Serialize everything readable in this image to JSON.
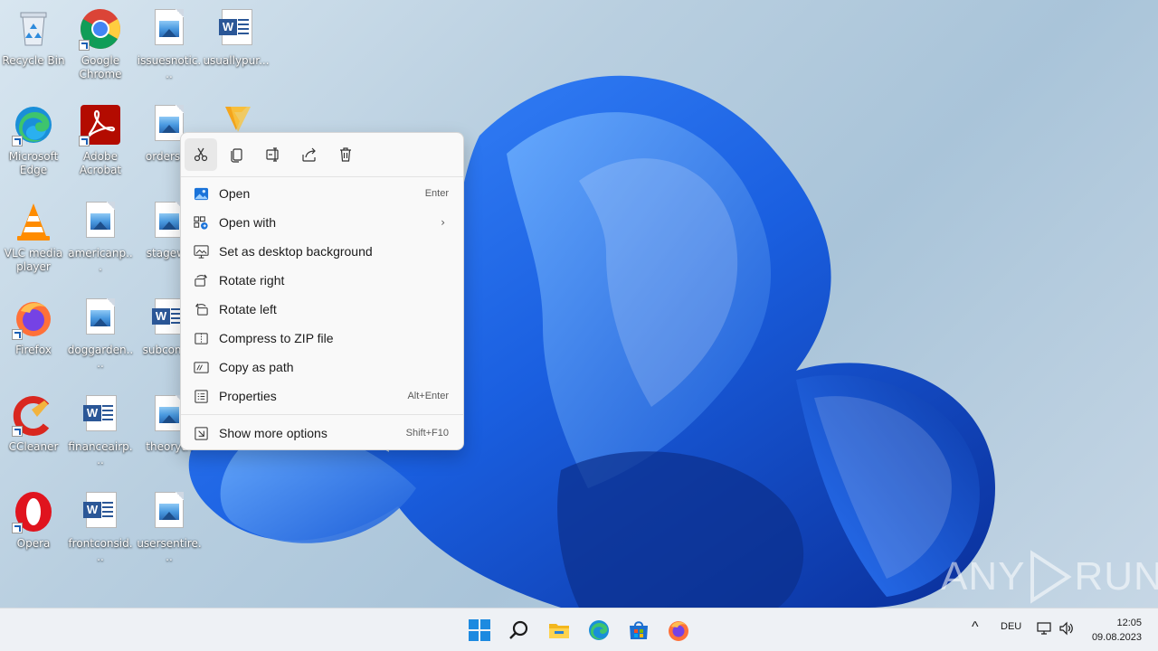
{
  "desktop": {
    "icons": [
      {
        "label": "Recycle Bin",
        "icon": "recycle-bin-icon"
      },
      {
        "label": "Google Chrome",
        "icon": "chrome-icon"
      },
      {
        "label": "issuesnotic...",
        "icon": "image-file-icon"
      },
      {
        "label": "usuallypur...",
        "icon": "word-file-icon"
      },
      {
        "label": "Microsoft Edge",
        "icon": "edge-icon"
      },
      {
        "label": "Adobe Acrobat",
        "icon": "acrobat-icon"
      },
      {
        "label": "ordersca",
        "icon": "image-file-icon"
      },
      {
        "label": "",
        "icon": "foxit-icon"
      },
      {
        "label": "VLC media player",
        "icon": "vlc-icon"
      },
      {
        "label": "americanp...",
        "icon": "image-file-icon"
      },
      {
        "label": "stagewo",
        "icon": "image-file-icon"
      },
      {
        "label": "Firefox",
        "icon": "firefox-icon"
      },
      {
        "label": "doggarden....",
        "icon": "image-file-icon"
      },
      {
        "label": "subcomm",
        "icon": "word-file-icon"
      },
      {
        "label": "CCleaner",
        "icon": "ccleaner-icon"
      },
      {
        "label": "financeairp...",
        "icon": "word-file-icon"
      },
      {
        "label": "theoryth",
        "icon": "image-file-icon"
      },
      {
        "label": "Opera",
        "icon": "opera-icon"
      },
      {
        "label": "frontconsid...",
        "icon": "word-file-icon"
      },
      {
        "label": "usersentire...",
        "icon": "image-file-icon"
      }
    ]
  },
  "context_menu": {
    "quick_actions": [
      {
        "icon": "cut-icon",
        "active": true
      },
      {
        "icon": "copy-icon",
        "active": false
      },
      {
        "icon": "rename-icon",
        "active": false
      },
      {
        "icon": "share-icon",
        "active": false
      },
      {
        "icon": "delete-icon",
        "active": false
      }
    ],
    "items": [
      {
        "label": "Open",
        "shortcut": "Enter",
        "icon": "photos-app-icon"
      },
      {
        "label": "Open with",
        "shortcut": "",
        "icon": "open-with-icon",
        "submenu": true
      },
      {
        "label": "Set as desktop background",
        "shortcut": "",
        "icon": "desktop-background-icon"
      },
      {
        "label": "Rotate right",
        "shortcut": "",
        "icon": "rotate-right-icon"
      },
      {
        "label": "Rotate left",
        "shortcut": "",
        "icon": "rotate-left-icon"
      },
      {
        "label": "Compress to ZIP file",
        "shortcut": "",
        "icon": "zip-icon"
      },
      {
        "label": "Copy as path",
        "shortcut": "",
        "icon": "copy-path-icon"
      },
      {
        "label": "Properties",
        "shortcut": "Alt+Enter",
        "icon": "properties-icon"
      },
      {
        "label": "Show more options",
        "shortcut": "Shift+F10",
        "icon": "more-options-icon"
      }
    ]
  },
  "taskbar": {
    "apps": [
      "start-icon",
      "search-icon",
      "file-explorer-icon",
      "edge-icon",
      "store-icon",
      "firefox-icon"
    ],
    "tray": {
      "language": "DEU",
      "time": "12:05",
      "date": "09.08.2023"
    }
  },
  "watermark": {
    "left": "ANY",
    "right": "RUN"
  },
  "colors": {
    "accent": "#1a5fb4",
    "wallpaper_bloom": "#1e6fe8",
    "menu_bg": "#f9f9f9",
    "taskbar_bg": "#eef1f5"
  }
}
